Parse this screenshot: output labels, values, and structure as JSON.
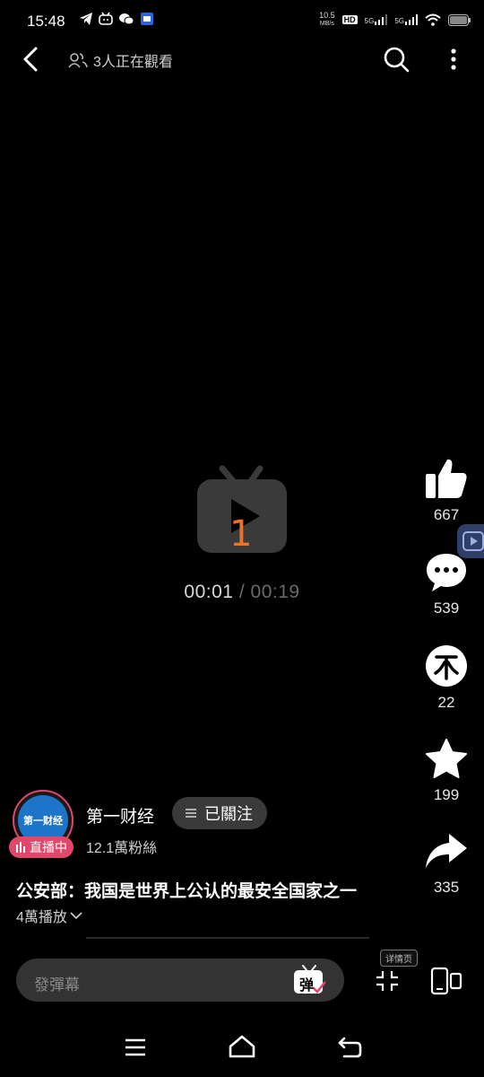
{
  "status_bar": {
    "time": "15:48",
    "network_speed_top": "10.5",
    "network_speed_bottom": "MB/s",
    "hd_label": "HD",
    "sim1_label": "5G",
    "sim2_label": "5G"
  },
  "top_bar": {
    "viewers_text": "3人正在觀看"
  },
  "player": {
    "overlay_digit": "1",
    "current_time": "00:01",
    "separator": "/",
    "total_time": "00:19",
    "accent_color": "#e8732c"
  },
  "actions": {
    "likes": "667",
    "comments": "539",
    "coins": "22",
    "favorites": "199",
    "shares": "335"
  },
  "channel": {
    "avatar_text": "第一财经",
    "live_badge": "直播中",
    "name": "第一财经",
    "follow_label": "已關注",
    "fans": "12.1萬粉絲"
  },
  "video": {
    "title": "公安部：我国是世界上公认的最安全国家之一",
    "play_count": "4萬播放"
  },
  "bottom_bar": {
    "danmaku_placeholder": "發彈幕",
    "danmaku_button": "弹",
    "detail_badge": "详情页"
  },
  "colors": {
    "background": "#000000",
    "live_pink": "#e0476a",
    "pill_gray": "#3a3a3a"
  }
}
